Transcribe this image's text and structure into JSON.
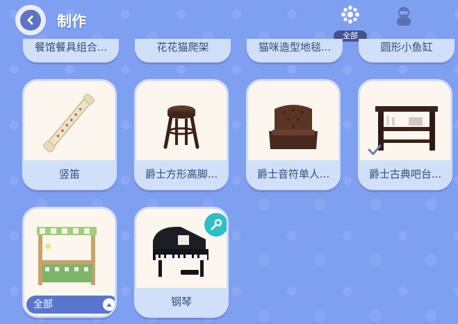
{
  "header": {
    "title": "制作",
    "filter_label": "全部"
  },
  "partial_row": [
    {
      "label": "餐馆餐具组合..."
    },
    {
      "label": "花花猫爬架"
    },
    {
      "label": "猫咪造型地毯..."
    },
    {
      "label": "圆形小鱼缸"
    }
  ],
  "items": [
    {
      "label": "竖笛",
      "icon": "recorder-icon"
    },
    {
      "label": "爵士方形高脚...",
      "icon": "bar-stool-icon"
    },
    {
      "label": "爵士音符单人...",
      "icon": "armchair-icon"
    },
    {
      "label": "爵士古典吧台...",
      "icon": "bar-counter-icon",
      "checked": true
    },
    {
      "label": "全部",
      "icon": "stall-icon",
      "is_filter_pill": true
    },
    {
      "label": "钢琴",
      "icon": "piano-icon",
      "has_wrench_badge": true
    }
  ],
  "colors": {
    "background": "#7f9ff0",
    "card": "#fcf6ee",
    "label_bg": "#cfe0f8",
    "accent": "#5876cf",
    "badge": "#2dbfc6"
  }
}
